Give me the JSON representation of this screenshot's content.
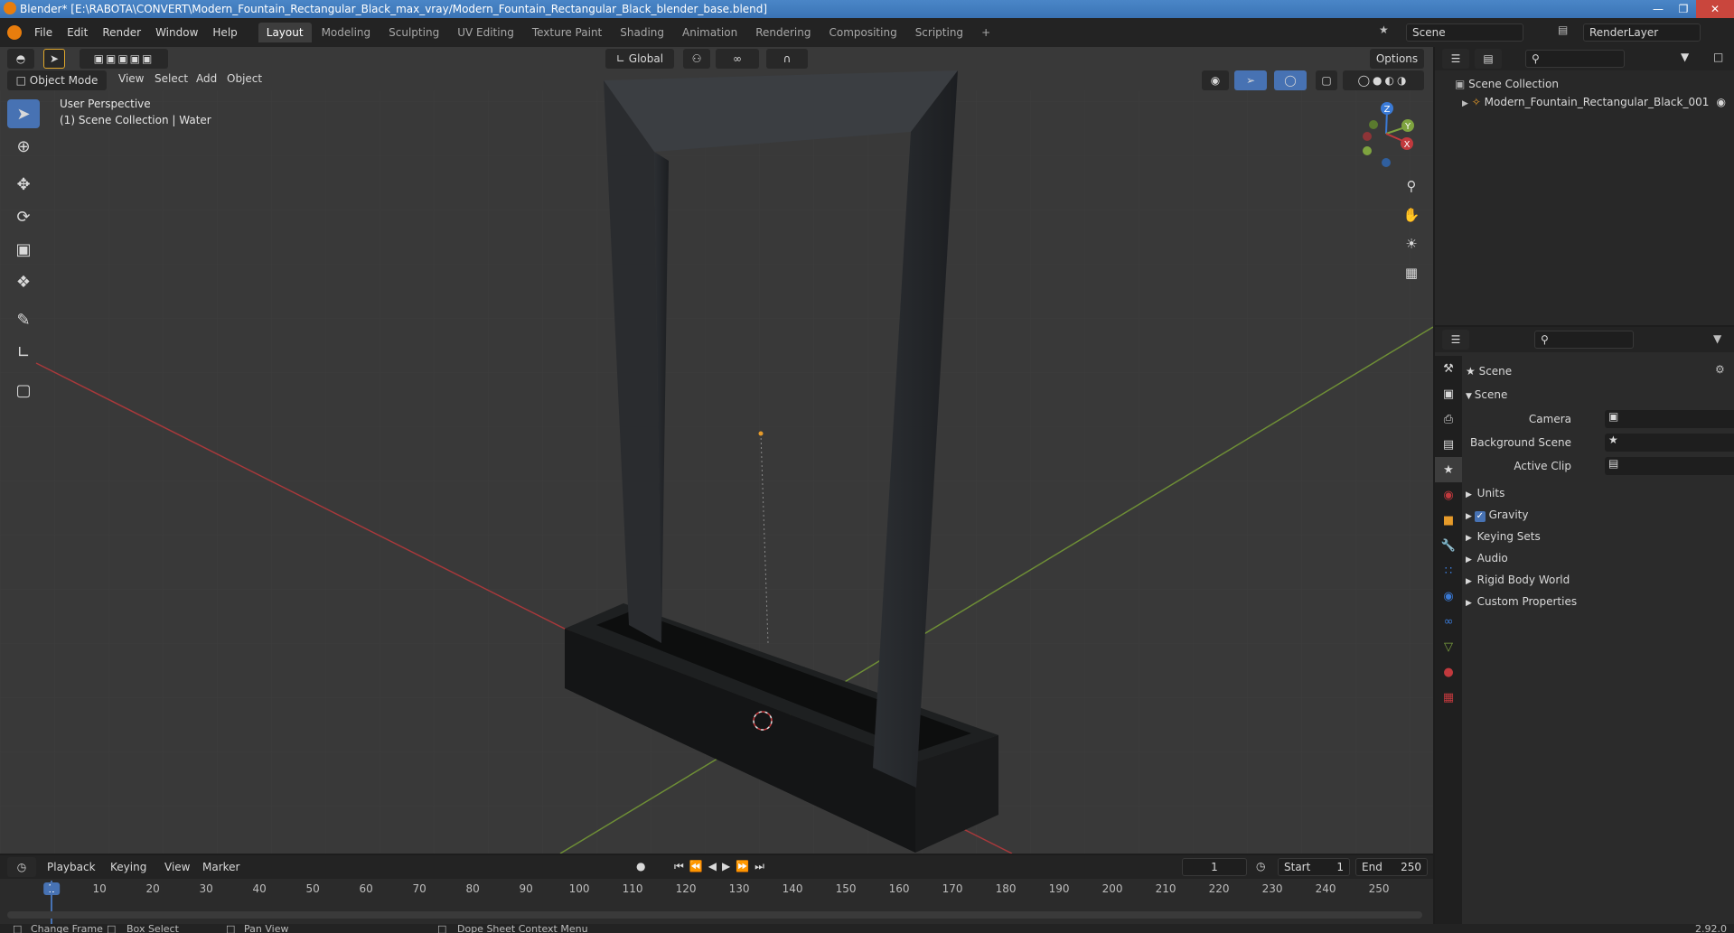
{
  "window": {
    "title": "Blender* [E:\\RABOTA\\CONVERT\\Modern_Fountain_Rectangular_Black_max_vray/Modern_Fountain_Rectangular_Black_blender_base.blend]"
  },
  "menu": {
    "items": [
      "File",
      "Edit",
      "Render",
      "Window",
      "Help"
    ]
  },
  "workspaces": {
    "tabs": [
      "Layout",
      "Modeling",
      "Sculpting",
      "UV Editing",
      "Texture Paint",
      "Shading",
      "Animation",
      "Rendering",
      "Compositing",
      "Scripting"
    ],
    "active": "Layout"
  },
  "scene_selector": {
    "value": "Scene"
  },
  "renderlayer_selector": {
    "value": "RenderLayer"
  },
  "viewport": {
    "transform_orientation": "Global",
    "options_label": "Options",
    "mode": "Object Mode",
    "header_menus": [
      "View",
      "Select",
      "Add",
      "Object"
    ],
    "overlay_line1": "User Perspective",
    "overlay_line2": "(1) Scene Collection | Water",
    "gizmo_axes": {
      "z": "Z",
      "y": "Y",
      "x": "X"
    }
  },
  "outliner": {
    "root": "Scene Collection",
    "items": [
      "Modern_Fountain_Rectangular_Black_001"
    ]
  },
  "properties": {
    "context_title": "Scene",
    "panel_title": "Scene",
    "fields": [
      {
        "label": "Camera"
      },
      {
        "label": "Background Scene"
      },
      {
        "label": "Active Clip"
      }
    ],
    "sections": [
      "Units",
      "Gravity",
      "Keying Sets",
      "Audio",
      "Rigid Body World",
      "Custom Properties"
    ],
    "gravity_checked": true
  },
  "timeline": {
    "menus": [
      "Playback",
      "Keying",
      "View",
      "Marker"
    ],
    "current_frame": "1",
    "start_label": "Start",
    "start_value": "1",
    "end_label": "End",
    "end_value": "250",
    "ruler_ticks": [
      "1",
      "10",
      "20",
      "30",
      "40",
      "50",
      "60",
      "70",
      "80",
      "90",
      "100",
      "110",
      "120",
      "130",
      "140",
      "150",
      "160",
      "170",
      "180",
      "190",
      "200",
      "210",
      "220",
      "230",
      "240",
      "250"
    ]
  },
  "statusbar": {
    "items": [
      "Change Frame",
      "Box Select",
      "Pan View",
      "Dope Sheet Context Menu"
    ],
    "version": "2.92.0"
  },
  "colors": {
    "accent": "#4772b3",
    "x_axis": "#c1393d",
    "y_axis": "#7ea33f",
    "z_axis": "#3a7ad6"
  }
}
